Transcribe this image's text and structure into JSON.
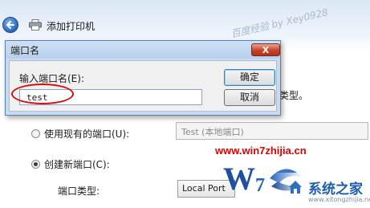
{
  "window": {
    "title": "添加打印机",
    "watermark": "百度经验 by Xey0928",
    "partial_text": "类型。"
  },
  "dialog": {
    "title": "端口名",
    "close_glyph": "X",
    "prompt_label": "输入端口名(E):",
    "port_name_value": "test",
    "ok_label": "确定",
    "cancel_label": "取消"
  },
  "options": {
    "existing_label": "使用现有的端口(U):",
    "existing_value": "Test (本地端口)",
    "existing_selected": false,
    "new_label": "创建新端口(C):",
    "new_selected": true,
    "port_type_label": "端口类型:",
    "port_type_value": "Local Port"
  },
  "overlay": {
    "site_url": "www.win7zhijia.cn",
    "site_name": "系统之家",
    "site_sub": "www.xitongzhijia.net"
  },
  "colors": {
    "accent": "#3c7fb1",
    "annotation": "#d21010",
    "site_red": "#e00000"
  }
}
